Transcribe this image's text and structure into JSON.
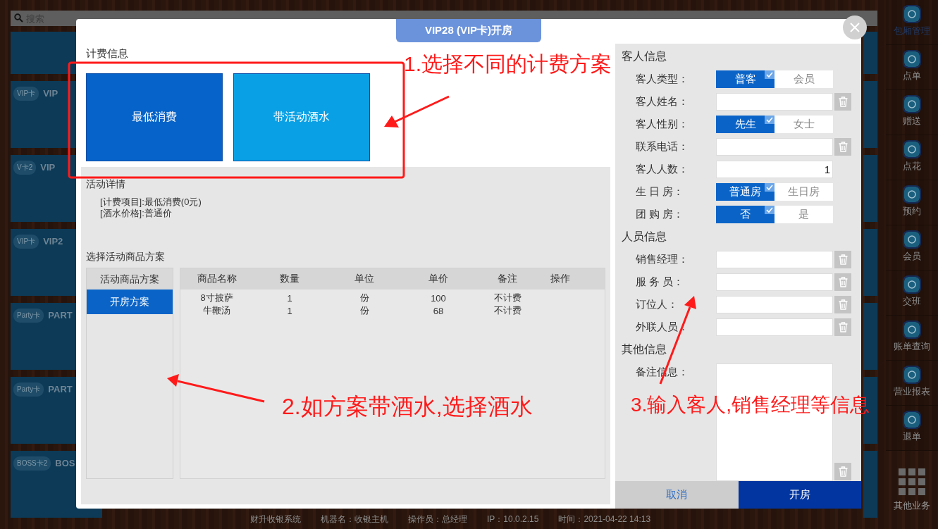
{
  "search": {
    "placeholder": "搜索"
  },
  "room_cards": [
    {
      "badge": "VIP卡",
      "name": "VIP"
    },
    {
      "badge": "V卡2",
      "name": "VIP"
    },
    {
      "badge": "VIP卡",
      "name": "VIP2"
    },
    {
      "badge": "Party卡",
      "name": "PART"
    },
    {
      "badge": "Party卡",
      "name": "PART"
    },
    {
      "badge": "BOSS卡2",
      "name": "BOS"
    }
  ],
  "sidebar": {
    "items": [
      {
        "label": "包厢管理",
        "selected": true
      },
      {
        "label": "点单",
        "selected": false
      },
      {
        "label": "赠送",
        "selected": false
      },
      {
        "label": "点花",
        "selected": false
      },
      {
        "label": "预约",
        "selected": false
      },
      {
        "label": "会员",
        "selected": false
      },
      {
        "label": "交班",
        "selected": false
      },
      {
        "label": "账单查询",
        "selected": false
      },
      {
        "label": "营业报表",
        "selected": false
      },
      {
        "label": "退单",
        "selected": false
      }
    ],
    "more": "其他业务"
  },
  "status_bar": [
    "财升收银系统",
    "机器名：收银主机",
    "操作员：总经理",
    "IP：10.0.2.15",
    "时间：2021-04-22 14:13"
  ],
  "dialog": {
    "title": "VIP28 (VIP卡)开房",
    "billing": {
      "heading": "计费信息",
      "plans": [
        {
          "label": "最低消费",
          "selected": true
        },
        {
          "label": "带活动酒水",
          "selected": false
        }
      ]
    },
    "activity": {
      "heading": "活动详情",
      "lines": [
        "[计费项目]:最低消费(0元)",
        "[酒水价格]:普通价"
      ]
    },
    "goods": {
      "heading": "选择活动商品方案",
      "plan_list": {
        "header": "活动商品方案",
        "items": [
          {
            "label": "开房方案",
            "selected": true
          }
        ]
      },
      "table": {
        "columns": [
          "商品名称",
          "数量",
          "单位",
          "单价",
          "备注",
          "操作"
        ],
        "rows": [
          [
            "8寸披萨",
            "1",
            "份",
            "100",
            "不计费"
          ],
          [
            "牛鞭汤",
            "1",
            "份",
            "68",
            "不计费"
          ]
        ]
      }
    },
    "guest": {
      "sections": [
        {
          "heading": "客人信息",
          "fields": [
            {
              "label": "客人类型：",
              "kind": "toggle",
              "options": [
                {
                  "label": "普客",
                  "selected": true
                },
                {
                  "label": "会员",
                  "selected": false
                }
              ]
            },
            {
              "label": "客人姓名：",
              "kind": "text",
              "clearable": true
            },
            {
              "label": "客人性别：",
              "kind": "toggle",
              "options": [
                {
                  "label": "先生",
                  "selected": true
                },
                {
                  "label": "女士",
                  "selected": false
                }
              ]
            },
            {
              "label": "联系电话：",
              "kind": "text",
              "clearable": true
            },
            {
              "label": "客人人数：",
              "kind": "text",
              "value": "1",
              "clearable": false
            },
            {
              "label": "生 日 房：",
              "kind": "toggle",
              "options": [
                {
                  "label": "普通房",
                  "selected": true
                },
                {
                  "label": "生日房",
                  "selected": false
                }
              ]
            },
            {
              "label": "团 购 房：",
              "kind": "toggle",
              "options": [
                {
                  "label": "否",
                  "selected": true
                },
                {
                  "label": "是",
                  "selected": false
                }
              ]
            }
          ]
        },
        {
          "heading": "人员信息",
          "fields": [
            {
              "label": "销售经理：",
              "kind": "text",
              "clearable": true
            },
            {
              "label": "服 务 员：",
              "kind": "text",
              "clearable": true
            },
            {
              "label": "订位人：",
              "kind": "text",
              "clearable": true
            },
            {
              "label": "外联人员：",
              "kind": "text",
              "clearable": true
            }
          ]
        },
        {
          "heading": "其他信息",
          "fields": [
            {
              "label": "备注信息：",
              "kind": "textarea",
              "clearable": true
            }
          ]
        }
      ],
      "buttons": [
        {
          "label": "取消",
          "kind": "secondary"
        },
        {
          "label": "开房",
          "kind": "primary"
        }
      ]
    }
  },
  "annotations": [
    "1.选择不同的计费方案",
    "2.如方案带酒水,选择酒水",
    "3.输入客人,销售经理等信息"
  ]
}
